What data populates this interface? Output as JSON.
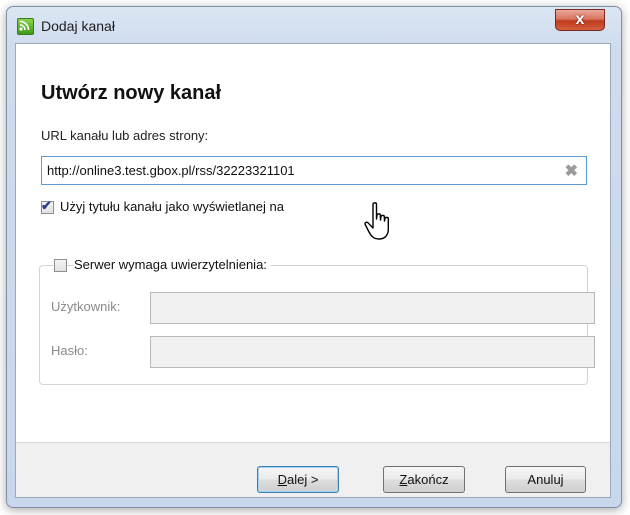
{
  "window": {
    "title": "Dodaj kanał",
    "close_glyph": "x"
  },
  "dialog": {
    "heading": "Utwórz nowy kanał",
    "url_label": "URL kanału lub adres strony:",
    "url_value": "http://online3.test.gbox.pl/rss/32223321101",
    "use_title": {
      "label": "Użyj tytułu kanału jako wyświetlanej na",
      "checked": true
    },
    "auth": {
      "label": "Serwer wymaga uwierzytelnienia:",
      "checked": false,
      "user_label": "Użytkownik:",
      "user_value": "",
      "pass_label": "Hasło:",
      "pass_value": ""
    }
  },
  "buttons": {
    "next_mnemonic": "D",
    "next_rest": "alej >",
    "finish_mnemonic": "Z",
    "finish_rest": "akończ",
    "cancel": "Anuluj"
  },
  "icons": {
    "app": "rss-feed-icon",
    "clear": "clear-x-icon",
    "cursor": "hand-pointer-cursor"
  }
}
